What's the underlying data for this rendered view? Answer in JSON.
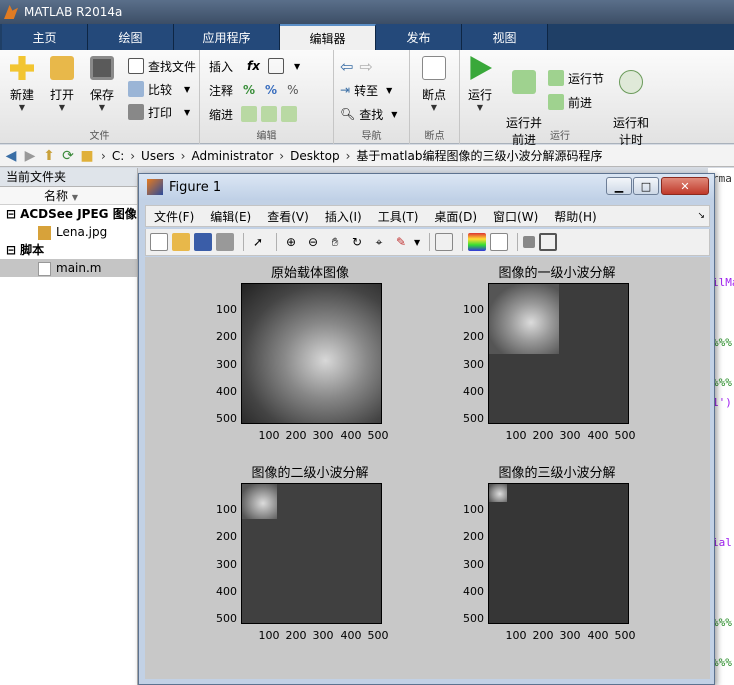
{
  "window": {
    "title": "MATLAB R2014a"
  },
  "tabs": [
    "主页",
    "绘图",
    "应用程序",
    "编辑器",
    "发布",
    "视图"
  ],
  "active_tab": "编辑器",
  "ribbon": {
    "file_group": {
      "label": "文件",
      "new": "新建",
      "open": "打开",
      "save": "保存",
      "find_files": "查找文件",
      "compare": "比较",
      "print": "打印"
    },
    "edit_group": {
      "label": "编辑",
      "insert": "插入",
      "comment": "注释",
      "indent": "缩进",
      "fx": "fx"
    },
    "nav_group": {
      "label": "导航",
      "goto": "转至",
      "find": "查找"
    },
    "bp_group": {
      "label": "断点",
      "breakpoints": "断点"
    },
    "run_group": {
      "label": "运行",
      "run": "运行",
      "run_advance": "运行并\n前进",
      "run_section": "运行节",
      "advance": "前进",
      "run_time": "运行和\n计时"
    }
  },
  "address": {
    "crumbs": [
      "C:",
      "Users",
      "Administrator",
      "Desktop",
      "基于matlab编程图像的三级小波分解源码程序"
    ]
  },
  "left_panel": {
    "title": "当前文件夹",
    "column": "名称",
    "items": [
      {
        "label": "ACDSee JPEG 图像",
        "type": "group"
      },
      {
        "label": "Lena.jpg",
        "type": "file"
      },
      {
        "label": "脚本",
        "type": "group"
      },
      {
        "label": "main.m",
        "type": "file"
      }
    ]
  },
  "editor_fragments": [
    "rma",
    "ilMa",
    "%%%",
    "%%%",
    "1')",
    "ial",
    "%%%",
    "%%%"
  ],
  "figure": {
    "title": "Figure 1",
    "menus": [
      "文件(F)",
      "编辑(E)",
      "查看(V)",
      "插入(I)",
      "工具(T)",
      "桌面(D)",
      "窗口(W)",
      "帮助(H)"
    ],
    "plots": [
      {
        "title": "原始载体图像",
        "yticks": [
          "100",
          "200",
          "300",
          "400",
          "500"
        ],
        "xticks": [
          "100",
          "200",
          "300",
          "400",
          "500"
        ]
      },
      {
        "title": "图像的一级小波分解",
        "yticks": [
          "100",
          "200",
          "300",
          "400",
          "500"
        ],
        "xticks": [
          "100",
          "200",
          "300",
          "400",
          "500"
        ]
      },
      {
        "title": "图像的二级小波分解",
        "yticks": [
          "100",
          "200",
          "300",
          "400",
          "500"
        ],
        "xticks": [
          "100",
          "200",
          "300",
          "400",
          "500"
        ]
      },
      {
        "title": "图像的三级小波分解",
        "yticks": [
          "100",
          "200",
          "300",
          "400",
          "500"
        ],
        "xticks": [
          "100",
          "200",
          "300",
          "400",
          "500"
        ]
      }
    ]
  },
  "colors": {
    "title_bar": "#3c4e66",
    "tab_row": "#1f3f66",
    "figure_bg": "#c8c8c8",
    "detail_dark": "#3a3a3a"
  }
}
